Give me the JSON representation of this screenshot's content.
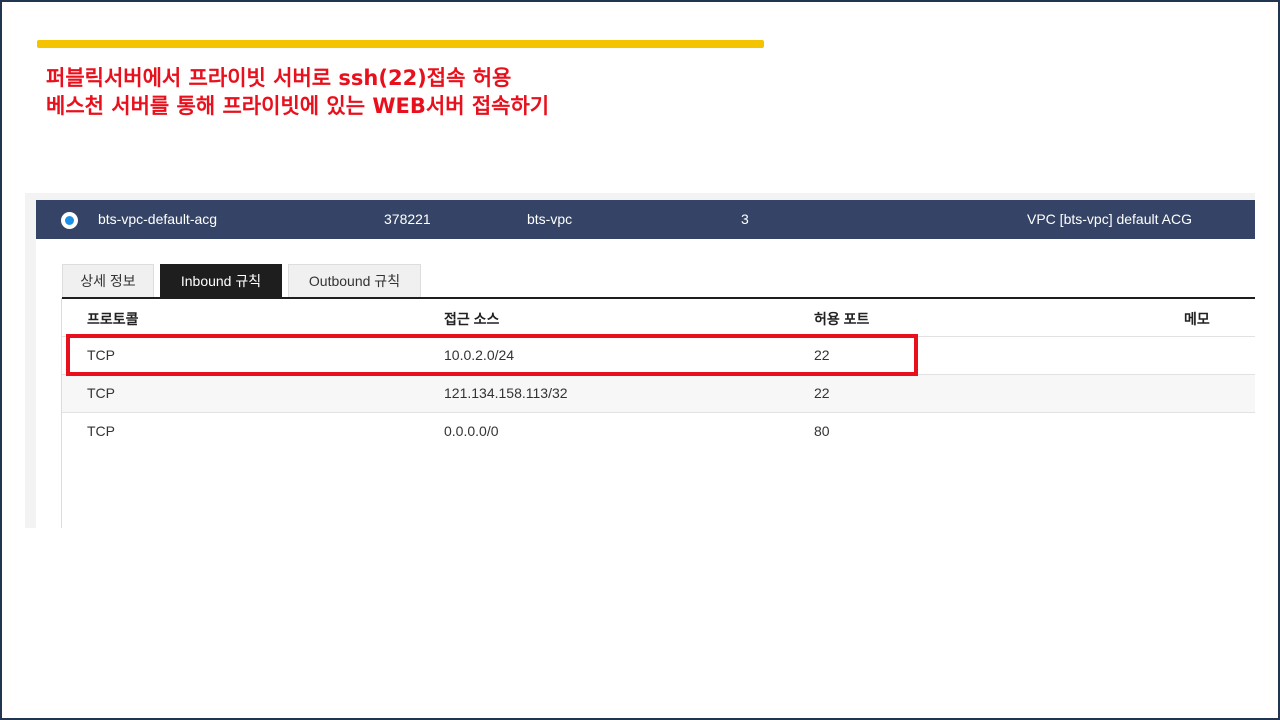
{
  "heading": {
    "line1": "퍼블릭서버에서 프라이빗 서버로 ssh(22)접속 허용",
    "line2": "베스천 서버를 통해 프라이빗에 있는 WEB서버 접속하기"
  },
  "acg": {
    "name": "bts-vpc-default-acg",
    "id": "378221",
    "vpc": "bts-vpc",
    "rule_count": "3",
    "description": "VPC [bts-vpc] default ACG"
  },
  "tabs": [
    {
      "label": "상세 정보",
      "active": false
    },
    {
      "label": "Inbound 규칙",
      "active": true
    },
    {
      "label": "Outbound 규칙",
      "active": false
    }
  ],
  "table": {
    "headers": [
      "프로토콜",
      "접근 소스",
      "허용 포트",
      "메모"
    ],
    "rows": [
      {
        "protocol": "TCP",
        "source": "10.0.2.0/24",
        "port": "22",
        "memo": ""
      },
      {
        "protocol": "TCP",
        "source": "121.134.158.113/32",
        "port": "22",
        "memo": ""
      },
      {
        "protocol": "TCP",
        "source": "0.0.0.0/0",
        "port": "80",
        "memo": ""
      }
    ]
  },
  "colors": {
    "accent": "#f5c400",
    "heading": "#e8101c",
    "acg_row": "#354466",
    "highlight": "#e8101c"
  }
}
